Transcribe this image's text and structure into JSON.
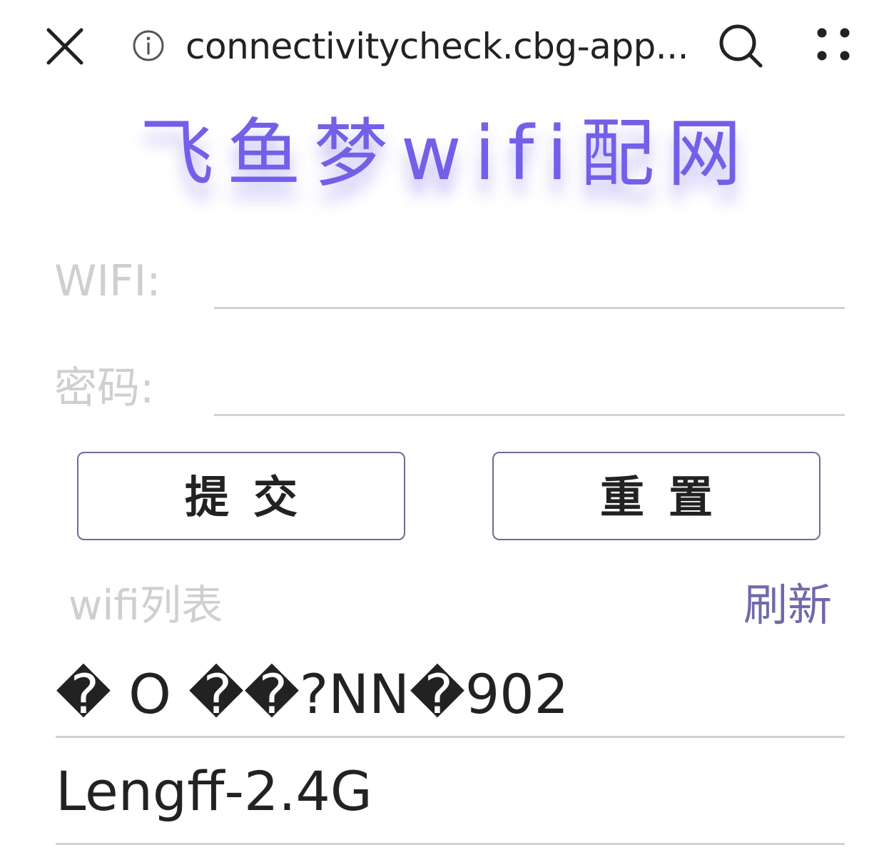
{
  "browser": {
    "url": "connectivitycheck.cbg-app....",
    "icons": {
      "close": "close-icon",
      "info": "info-icon",
      "search": "search-icon",
      "more": "more-dots-icon"
    }
  },
  "hero": {
    "title": "飞鱼梦wifi配网",
    "color": "#7260E8"
  },
  "form": {
    "wifi_label": "WIFI:",
    "wifi_value": "",
    "password_label": "密码:",
    "password_value": ""
  },
  "buttons": {
    "submit_label": "提交",
    "reset_label": "重置"
  },
  "wifi_list": {
    "title": "wifi列表",
    "refresh_label": "刷新",
    "refresh_color": "#6f6aa8",
    "items": [
      {
        "ssid": "� O ��?NN�902"
      },
      {
        "ssid": "Lengff-2.4G"
      }
    ]
  }
}
